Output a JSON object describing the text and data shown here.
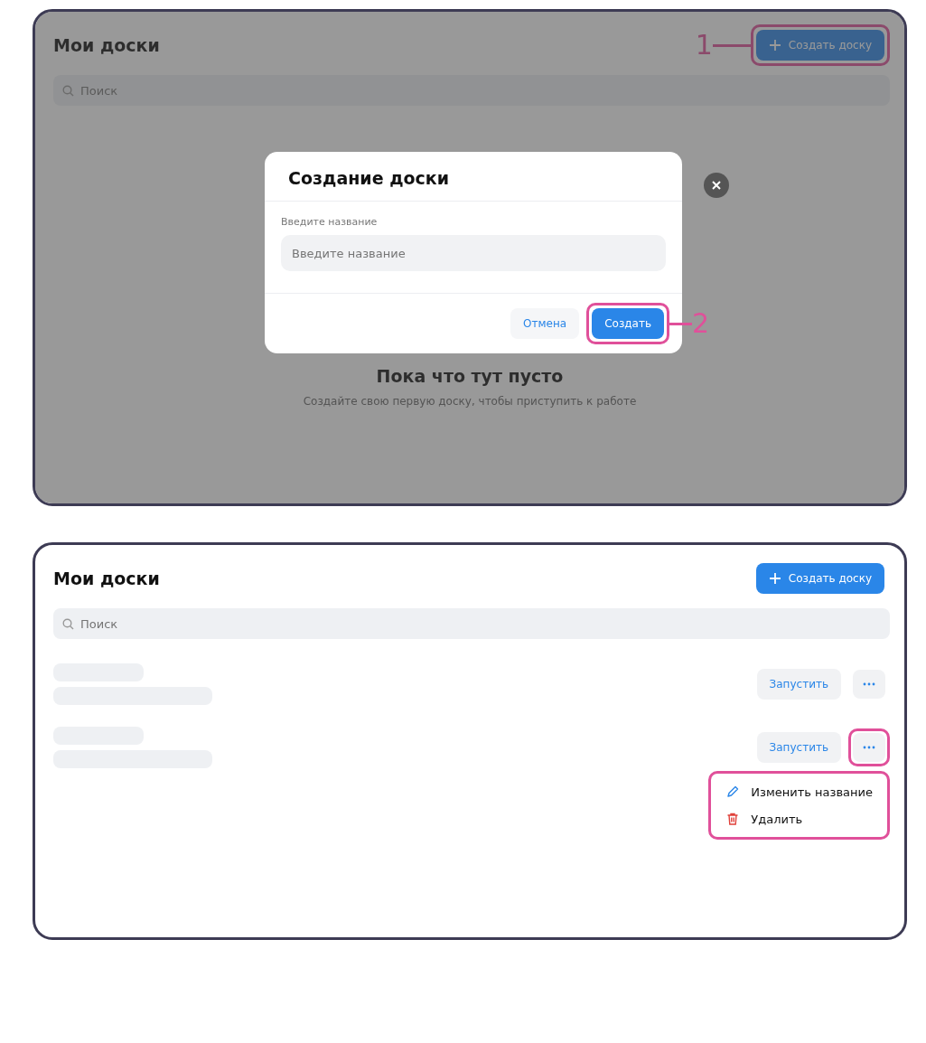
{
  "top_screen": {
    "title": "Мои доски",
    "create_button": {
      "label": "Создать доску",
      "highlighted": true,
      "callout": "1"
    },
    "search": {
      "placeholder": "Поиск"
    },
    "empty_state": {
      "title": "Пока что тут пусто",
      "text": "Создайте свою первую доску, чтобы приступить к работе"
    },
    "dialog": {
      "title": "Создание доски",
      "field_label": "Введите название",
      "field_placeholder": "Введите название",
      "cancel": "Отмена",
      "submit": {
        "label": "Создать",
        "highlighted": true,
        "callout": "2"
      }
    }
  },
  "bottom_screen": {
    "title": "Мои доски",
    "create_button": {
      "label": "Создать доску",
      "highlighted": false
    },
    "search": {
      "placeholder": "Поиск"
    },
    "boards": [
      {
        "run_label": "Запустить",
        "more_highlighted": false
      },
      {
        "run_label": "Запустить",
        "more_highlighted": true
      }
    ],
    "menu": {
      "highlighted": true,
      "items": [
        {
          "kind": "edit",
          "label": "Изменить название"
        },
        {
          "kind": "delete",
          "label": "Удалить"
        }
      ]
    }
  }
}
